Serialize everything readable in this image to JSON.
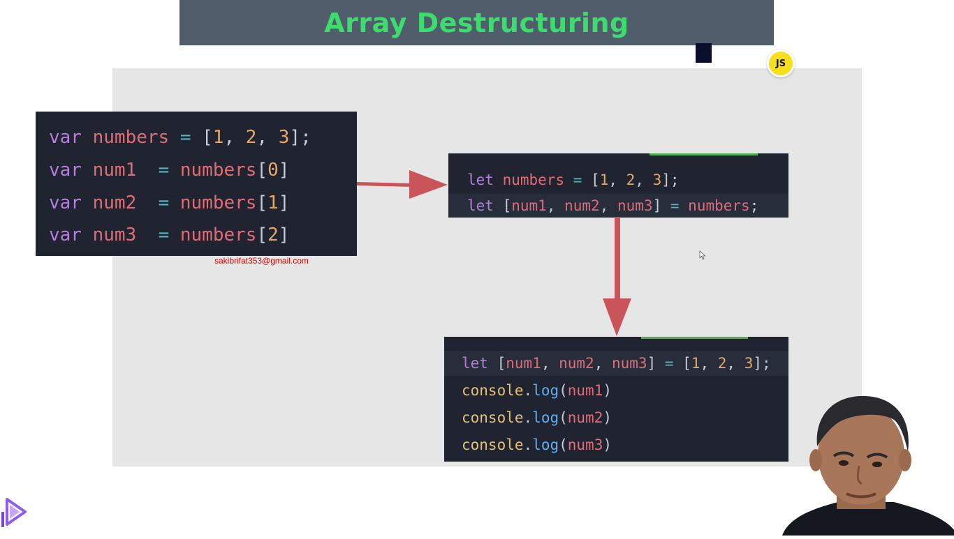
{
  "banner": {
    "title": "Array Destructuring"
  },
  "badge": {
    "label": "JS"
  },
  "email": "sakibrifat353@gmail.com",
  "code_blocks": {
    "old": {
      "lines": [
        [
          {
            "t": "kw",
            "v": "var"
          },
          {
            "t": "br",
            "v": " "
          },
          {
            "t": "var",
            "v": "numbers"
          },
          {
            "t": "br",
            "v": " "
          },
          {
            "t": "op",
            "v": "="
          },
          {
            "t": "br",
            "v": " ["
          },
          {
            "t": "num",
            "v": "1"
          },
          {
            "t": "br",
            "v": ", "
          },
          {
            "t": "num",
            "v": "2"
          },
          {
            "t": "br",
            "v": ", "
          },
          {
            "t": "num",
            "v": "3"
          },
          {
            "t": "br",
            "v": "];"
          }
        ],
        [
          {
            "t": "kw",
            "v": "var"
          },
          {
            "t": "br",
            "v": " "
          },
          {
            "t": "var",
            "v": "num1"
          },
          {
            "t": "br",
            "v": "  "
          },
          {
            "t": "op",
            "v": "="
          },
          {
            "t": "br",
            "v": " "
          },
          {
            "t": "var",
            "v": "numbers"
          },
          {
            "t": "br",
            "v": "["
          },
          {
            "t": "num",
            "v": "0"
          },
          {
            "t": "br",
            "v": "]"
          }
        ],
        [
          {
            "t": "kw",
            "v": "var"
          },
          {
            "t": "br",
            "v": " "
          },
          {
            "t": "var",
            "v": "num2"
          },
          {
            "t": "br",
            "v": "  "
          },
          {
            "t": "op",
            "v": "="
          },
          {
            "t": "br",
            "v": " "
          },
          {
            "t": "var",
            "v": "numbers"
          },
          {
            "t": "br",
            "v": "["
          },
          {
            "t": "num",
            "v": "1"
          },
          {
            "t": "br",
            "v": "]"
          }
        ],
        [
          {
            "t": "kw",
            "v": "var"
          },
          {
            "t": "br",
            "v": " "
          },
          {
            "t": "var",
            "v": "num3"
          },
          {
            "t": "br",
            "v": "  "
          },
          {
            "t": "op",
            "v": "="
          },
          {
            "t": "br",
            "v": " "
          },
          {
            "t": "var",
            "v": "numbers"
          },
          {
            "t": "br",
            "v": "["
          },
          {
            "t": "num",
            "v": "2"
          },
          {
            "t": "br",
            "v": "]"
          }
        ]
      ]
    },
    "destructure": {
      "lines": [
        [
          {
            "t": "kw",
            "v": "let"
          },
          {
            "t": "br",
            "v": " "
          },
          {
            "t": "var",
            "v": "numbers"
          },
          {
            "t": "br",
            "v": " "
          },
          {
            "t": "op",
            "v": "="
          },
          {
            "t": "br",
            "v": " ["
          },
          {
            "t": "num",
            "v": "1"
          },
          {
            "t": "br",
            "v": ", "
          },
          {
            "t": "num",
            "v": "2"
          },
          {
            "t": "br",
            "v": ", "
          },
          {
            "t": "num",
            "v": "3"
          },
          {
            "t": "br",
            "v": "];"
          }
        ],
        [
          {
            "t": "kw",
            "v": "let"
          },
          {
            "t": "br",
            "v": " ["
          },
          {
            "t": "var",
            "v": "num1"
          },
          {
            "t": "br",
            "v": ", "
          },
          {
            "t": "var",
            "v": "num2"
          },
          {
            "t": "br",
            "v": ", "
          },
          {
            "t": "var",
            "v": "num3"
          },
          {
            "t": "br",
            "v": "] "
          },
          {
            "t": "op",
            "v": "="
          },
          {
            "t": "br",
            "v": " "
          },
          {
            "t": "var",
            "v": "numbers"
          },
          {
            "t": "br",
            "v": ";"
          }
        ]
      ]
    },
    "direct": {
      "lines": [
        [
          {
            "t": "kw",
            "v": "let"
          },
          {
            "t": "br",
            "v": " ["
          },
          {
            "t": "var",
            "v": "num1"
          },
          {
            "t": "br",
            "v": ", "
          },
          {
            "t": "var",
            "v": "num2"
          },
          {
            "t": "br",
            "v": ", "
          },
          {
            "t": "var",
            "v": "num3"
          },
          {
            "t": "br",
            "v": "] "
          },
          {
            "t": "op",
            "v": "="
          },
          {
            "t": "br",
            "v": " ["
          },
          {
            "t": "num",
            "v": "1"
          },
          {
            "t": "br",
            "v": ", "
          },
          {
            "t": "num",
            "v": "2"
          },
          {
            "t": "br",
            "v": ", "
          },
          {
            "t": "num",
            "v": "3"
          },
          {
            "t": "br",
            "v": "];"
          }
        ],
        [
          {
            "t": "obj",
            "v": "console"
          },
          {
            "t": "br",
            "v": "."
          },
          {
            "t": "fn",
            "v": "log"
          },
          {
            "t": "br",
            "v": "("
          },
          {
            "t": "var",
            "v": "num1"
          },
          {
            "t": "br",
            "v": ")"
          }
        ],
        [
          {
            "t": "obj",
            "v": "console"
          },
          {
            "t": "br",
            "v": "."
          },
          {
            "t": "fn",
            "v": "log"
          },
          {
            "t": "br",
            "v": "("
          },
          {
            "t": "var",
            "v": "num2"
          },
          {
            "t": "br",
            "v": ")"
          }
        ],
        [
          {
            "t": "obj",
            "v": "console"
          },
          {
            "t": "br",
            "v": "."
          },
          {
            "t": "fn",
            "v": "log"
          },
          {
            "t": "br",
            "v": "("
          },
          {
            "t": "var",
            "v": "num3"
          },
          {
            "t": "br",
            "v": ")"
          }
        ]
      ]
    }
  },
  "colors": {
    "banner_bg": "#4f5e6a",
    "title": "#3ddc6e",
    "arrow": "#c9555b",
    "code_bg": "#1f2430",
    "keyword": "#b57edc",
    "variable": "#e06c75",
    "number": "#e5a86b",
    "operator": "#56b6c2",
    "email": "#e00000"
  },
  "icons": {
    "logo": "play-logo-icon",
    "cursor": "mouse-cursor-icon"
  }
}
